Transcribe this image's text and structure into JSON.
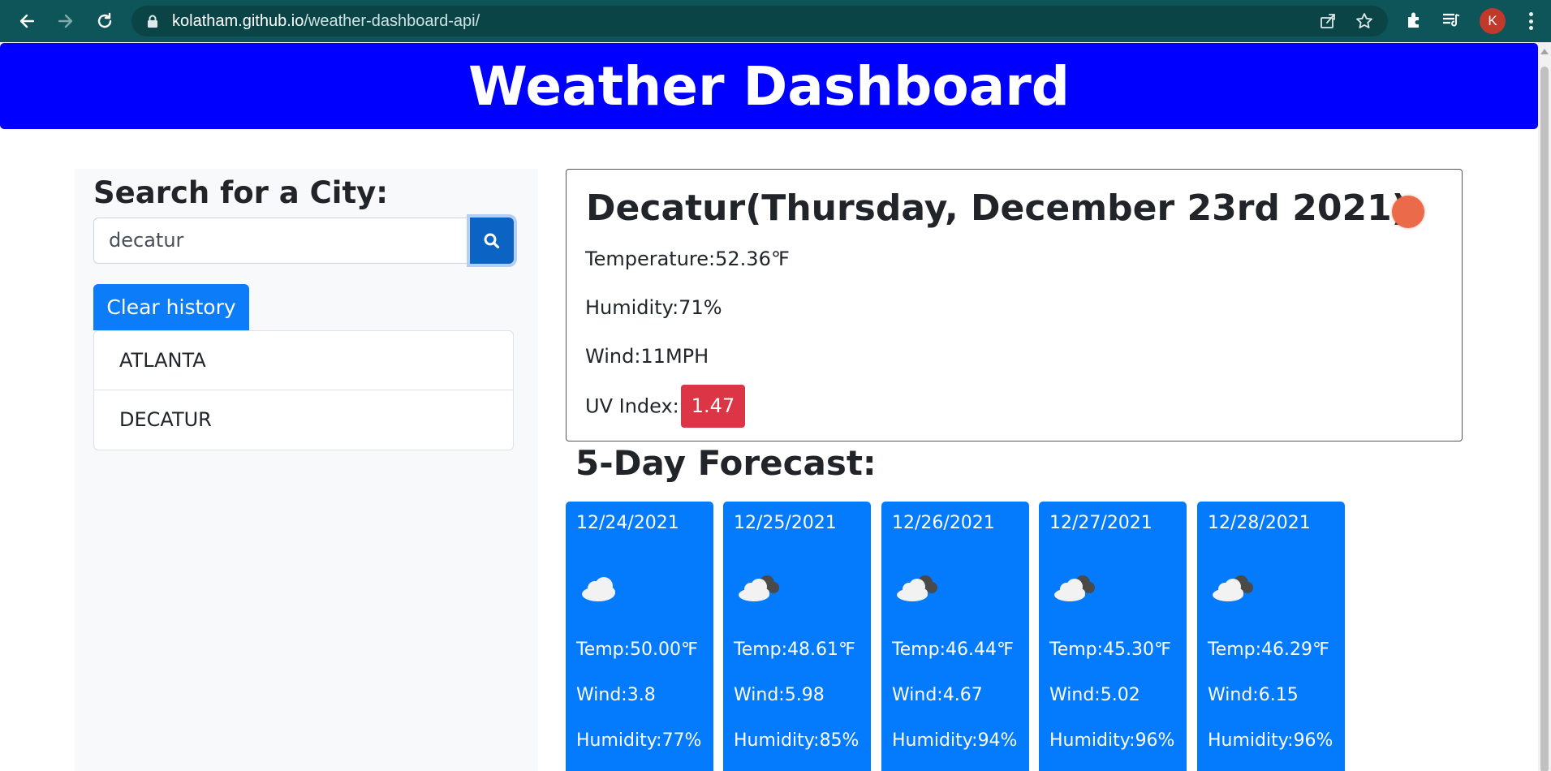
{
  "browser": {
    "url_host": "kolatham.github.io",
    "url_path": "/weather-dashboard-api/",
    "profile_initial": "K"
  },
  "header": {
    "title": "Weather Dashboard"
  },
  "sidebar": {
    "title": "Search for a City:",
    "search_value": "decatur",
    "clear_label": "Clear history",
    "history": [
      "ATLANTA",
      "DECATUR"
    ]
  },
  "current": {
    "title": "Decatur(Thursday, December 23rd 2021)",
    "temperature_label": "Temperature:",
    "temperature": "52.36℉",
    "humidity_label": "Humidity:",
    "humidity": "71%",
    "wind_label": "Wind:",
    "wind": "11MPH",
    "uv_label": "UV Index:",
    "uv": "1.47",
    "uv_color": "#dc3545",
    "icon": "clear-sun-icon"
  },
  "forecast": {
    "title": "5-Day Forecast:",
    "days": [
      {
        "date": "12/24/2021",
        "icon": "cloud-icon",
        "temp": "Temp:50.00℉",
        "wind": "Wind:3.8",
        "humidity": "Humidity:77%"
      },
      {
        "date": "12/25/2021",
        "icon": "broken-clouds-icon",
        "temp": "Temp:48.61℉",
        "wind": "Wind:5.98",
        "humidity": "Humidity:85%"
      },
      {
        "date": "12/26/2021",
        "icon": "broken-clouds-icon",
        "temp": "Temp:46.44℉",
        "wind": "Wind:4.67",
        "humidity": "Humidity:94%"
      },
      {
        "date": "12/27/2021",
        "icon": "broken-clouds-icon",
        "temp": "Temp:45.30℉",
        "wind": "Wind:5.02",
        "humidity": "Humidity:96%"
      },
      {
        "date": "12/28/2021",
        "icon": "broken-clouds-icon",
        "temp": "Temp:46.29℉",
        "wind": "Wind:6.15",
        "humidity": "Humidity:96%"
      }
    ]
  },
  "colors": {
    "header_bg": "#0000fe",
    "card_bg": "#047afc",
    "search_button": "#0b63c4",
    "clear_button": "#0d7cf9",
    "browser_bar": "#0d5558"
  }
}
